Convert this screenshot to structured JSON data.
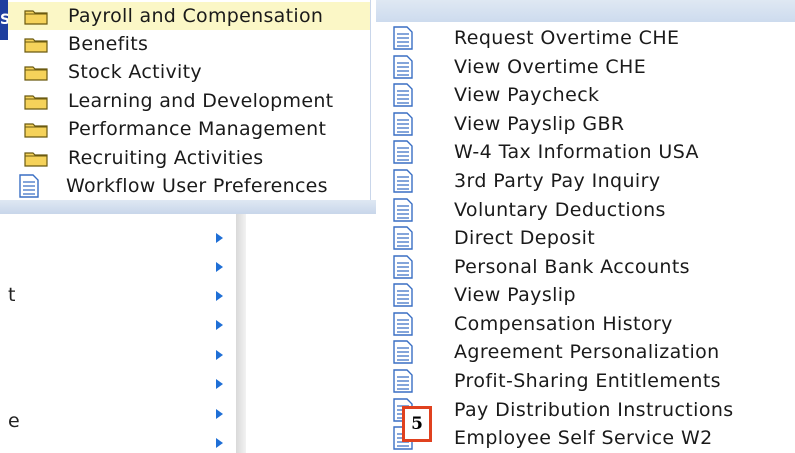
{
  "corner_tab": "S",
  "left_menu": {
    "items": [
      {
        "label": "Payroll and Compensation",
        "icon": "folder-icon",
        "highlighted": true
      },
      {
        "label": "Benefits",
        "icon": "folder-icon"
      },
      {
        "label": "Stock Activity",
        "icon": "folder-icon"
      },
      {
        "label": "Learning and Development",
        "icon": "folder-icon"
      },
      {
        "label": "Performance Management",
        "icon": "folder-icon"
      },
      {
        "label": "Recruiting Activities",
        "icon": "folder-icon"
      },
      {
        "label": "Workflow User Preferences",
        "icon": "document-icon"
      }
    ]
  },
  "background_fragments": [
    "t",
    "e"
  ],
  "submenu": {
    "items": [
      "Request Overtime CHE",
      "View Overtime CHE",
      "View Paycheck",
      "View Payslip GBR",
      "W-4 Tax Information USA",
      "3rd Party Pay Inquiry",
      "Voluntary Deductions",
      "Direct Deposit",
      "Personal Bank Accounts",
      "View Payslip",
      "Compensation History",
      "Agreement Personalization",
      "Profit-Sharing Entitlements",
      "Pay Distribution Instructions",
      "Employee Self Service W2"
    ]
  },
  "step_badge": "5",
  "colors": {
    "highlight": "#fbf7c6",
    "badge_border": "#e0411f",
    "arrow": "#1f6fd6",
    "folder": "#e6b800",
    "doc_line": "#3a6fc4"
  }
}
